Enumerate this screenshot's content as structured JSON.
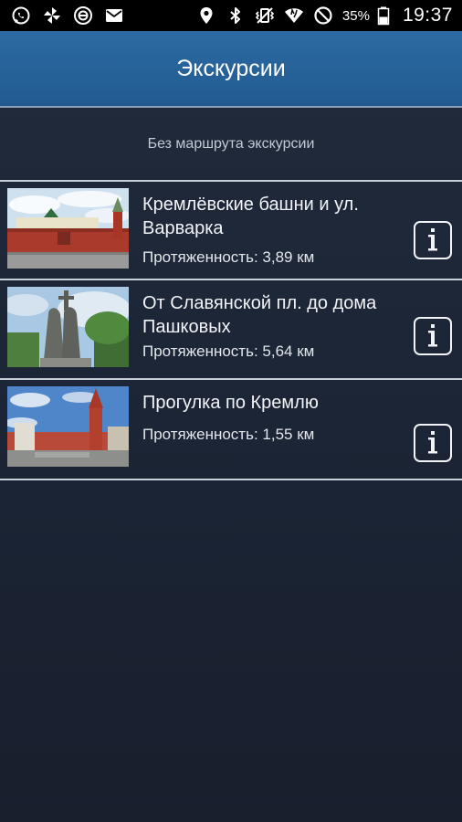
{
  "status_bar": {
    "left_icons": [
      "whatsapp-icon",
      "pinwheel-icon",
      "sync-icon",
      "mail-icon"
    ],
    "right_icons": [
      "location-icon",
      "bluetooth-icon",
      "vibrate-icon",
      "wifi-icon",
      "do-not-disturb-icon",
      "battery-icon"
    ],
    "battery_percent": "35%",
    "time": "19:37"
  },
  "header": {
    "title": "Экскурсии"
  },
  "no_route": {
    "label": "Без маршрута экскурсии"
  },
  "tours": [
    {
      "title": "Кремлёвские башни и ул. Варварка",
      "length": "Протяженность: 3,89 км",
      "image": "red-square-kremlin-wall-photo"
    },
    {
      "title": "От Славянской пл. до дома Пашковых",
      "length": "Протяженность: 5,64 км",
      "image": "cyril-methodius-monument-photo"
    },
    {
      "title": "Прогулка по Кремлю",
      "length": "Протяженность: 1,55 км",
      "image": "kremlin-troitskaya-tower-photo"
    }
  ],
  "info_icon": "info-icon",
  "colors": {
    "header_blue": "#2d6aa3",
    "background": "#1d2637",
    "divider": "#c7ced8"
  }
}
